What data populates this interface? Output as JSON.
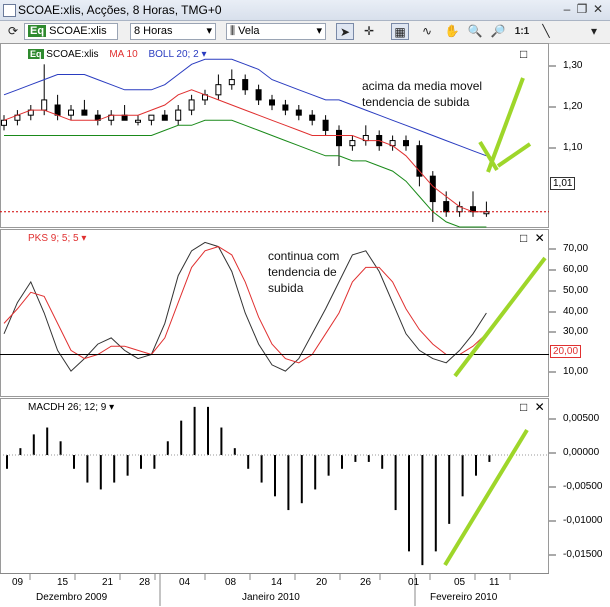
{
  "window": {
    "title": "SCOAE:xlis, Acções, 8 Horas, TMG+0"
  },
  "toolbar": {
    "symbol_badge": "Eq",
    "symbol": "SCOAE:xlis",
    "timeframe": "8 Horas",
    "chart_style": "Vela",
    "zoom_label": "1:1"
  },
  "price_panel": {
    "symbol": "SCOAE:xlis",
    "ma_label": "MA 10",
    "boll_label": "BOLL 20; 2",
    "current_price": "1,01",
    "y_ticks": [
      "1,30",
      "1,20",
      "1,10",
      "1,01"
    ],
    "annotation_line1": "acima da media movel",
    "annotation_line2": "tendencia de subida"
  },
  "pks_panel": {
    "label": "PKS 9; 5; 5",
    "level": "20,00",
    "y_ticks": [
      "70,00",
      "60,00",
      "50,00",
      "40,00",
      "30,00",
      "10,00"
    ],
    "annotation_line1": "continua com",
    "annotation_line2": "tendencia de",
    "annotation_line3": "subida"
  },
  "macd_panel": {
    "label": "MACDH 26; 12; 9",
    "y_ticks": [
      "0,00500",
      "0,00000",
      "-0,00500",
      "-0,01000",
      "-0,01500"
    ]
  },
  "x_axis": {
    "days": [
      "09",
      "15",
      "21",
      "28",
      "04",
      "08",
      "14",
      "20",
      "26",
      "01",
      "05",
      "11"
    ],
    "months": [
      "Dezembro 2009",
      "Janeiro 2010",
      "Fevereiro 2010"
    ]
  },
  "colors": {
    "ma": "#e03030",
    "boll_upper": "#2a3cc0",
    "boll_lower": "#1a8a1a",
    "pks_k": "#333333",
    "pks_d": "#e03030",
    "annotation_arrow": "#9ed62a",
    "current_line": "#d00000"
  },
  "chart_data": [
    {
      "type": "candlestick",
      "series": [
        {
          "name": "MA 10",
          "values": [
            1.19,
            1.2,
            1.21,
            1.21,
            1.2,
            1.19,
            1.19,
            1.19,
            1.2,
            1.2,
            1.2,
            1.21,
            1.22,
            1.24,
            1.25,
            1.24,
            1.23,
            1.22,
            1.21,
            1.2,
            1.19,
            1.18,
            1.17,
            1.16,
            1.16,
            1.16,
            1.16,
            1.15,
            1.15,
            1.14,
            1.12,
            1.09,
            1.06,
            1.04,
            1.02,
            1.01,
            1.01
          ]
        },
        {
          "name": "BOLL 20; 2",
          "values": []
        }
      ],
      "last": 1.01,
      "ylim": [
        0.98,
        1.34
      ]
    },
    {
      "type": "line",
      "name": "PKS 9; 5; 5",
      "level": 20,
      "ylim": [
        0,
        80
      ]
    },
    {
      "type": "bar",
      "name": "MACDH 26; 12; 9",
      "ylim": [
        -0.017,
        0.008
      ]
    }
  ]
}
